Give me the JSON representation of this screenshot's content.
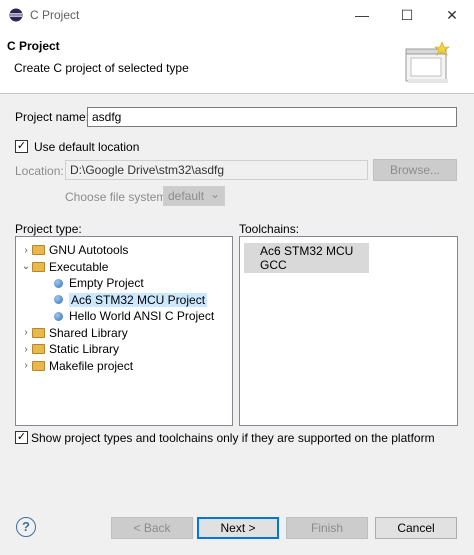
{
  "window": {
    "title": "C Project",
    "minimize_glyph": "—",
    "maximize_glyph": "☐",
    "close_glyph": "✕"
  },
  "header": {
    "title": "C Project",
    "description": "Create C project of selected type"
  },
  "project_name": {
    "label": "Project name:",
    "value": "asdfg"
  },
  "default_location": {
    "label": "Use default location",
    "checked": true,
    "check_glyph": "✓"
  },
  "location": {
    "label": "Location:",
    "value": "D:\\Google Drive\\stm32\\asdfg",
    "browse_label": "Browse..."
  },
  "file_system": {
    "label": "Choose file system:",
    "value": "default",
    "chevron": "⌄"
  },
  "project_type": {
    "label": "Project type:",
    "items": [
      {
        "label": "GNU Autotools",
        "kind": "folder",
        "expand": "›"
      },
      {
        "label": "Executable",
        "kind": "folder",
        "expand": "⌄"
      },
      {
        "label": "Empty Project",
        "kind": "item"
      },
      {
        "label": "Ac6 STM32 MCU Project",
        "kind": "item",
        "selected": true
      },
      {
        "label": "Hello World ANSI C Project",
        "kind": "item"
      },
      {
        "label": "Shared Library",
        "kind": "folder",
        "expand": "›"
      },
      {
        "label": "Static Library",
        "kind": "folder",
        "expand": "›"
      },
      {
        "label": "Makefile project",
        "kind": "folder",
        "expand": "›"
      }
    ]
  },
  "toolchains": {
    "label": "Toolchains:",
    "items": [
      "Ac6 STM32 MCU GCC"
    ]
  },
  "platform_filter": {
    "label": "Show project types and toolchains only if they are supported on the platform",
    "checked": true,
    "check_glyph": "✓"
  },
  "footer": {
    "help_glyph": "?",
    "back_label": "< Back",
    "next_label": "Next >",
    "finish_label": "Finish",
    "cancel_label": "Cancel"
  },
  "colors": {
    "accent": "#0078d7",
    "selection": "#cce8ff"
  }
}
